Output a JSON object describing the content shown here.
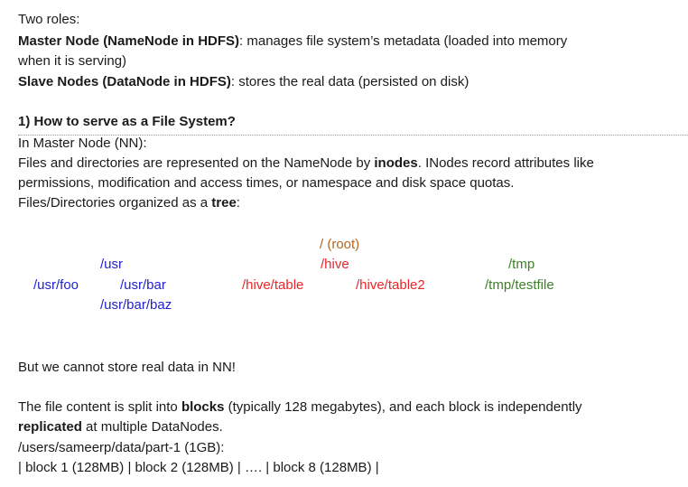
{
  "intro": {
    "two_roles": "Two roles:",
    "master_bold": "Master Node (NameNode in HDFS)",
    "master_rest": ": manages file system’s metadata (loaded into memory",
    "master_cont": "when it is serving)",
    "slave_bold": "Slave Nodes (DataNode in HDFS)",
    "slave_rest": ": stores the real data (persisted on disk)"
  },
  "section1": {
    "heading": "1) How to serve as a File System?",
    "in_master": "In Master Node (NN):",
    "p1_a": "Files and directories are represented on the NameNode by ",
    "p1_bold": "inodes",
    "p1_b": ". INodes record attributes like",
    "p1_line2": "permissions, modification and access times, or namespace and disk space quotas.",
    "p2_a": "Files/Directories organized as a ",
    "p2_bold": "tree",
    "p2_b": ":"
  },
  "tree": {
    "root": "/ (root)",
    "usr": "/usr",
    "hive": "/hive",
    "tmp": "/tmp",
    "usr_foo": "/usr/foo",
    "usr_bar": "/usr/bar",
    "hive_table": "/hive/table",
    "hive_table2": "/hive/table2",
    "tmp_testfile": "/tmp/testfile",
    "usr_bar_baz": "/usr/bar/baz",
    "colors": {
      "root": "#b5651d",
      "usr": "#2222cc",
      "hive": "#e8262b",
      "tmp": "#3f7f2a"
    }
  },
  "section2": {
    "cannot_store": "But we cannot store real data in NN!",
    "p3_a": "The file content is split into ",
    "p3_bold1": "blocks",
    "p3_b": " (typically 128 megabytes), and each block is independently",
    "p3_bold2": "replicated",
    "p3_c": " at multiple DataNodes.",
    "path": "/users/sameerp/data/part-1 (1GB):",
    "blocks": "| block 1 (128MB) | block 2 (128MB) | ….  | block 8 (128MB) |"
  }
}
